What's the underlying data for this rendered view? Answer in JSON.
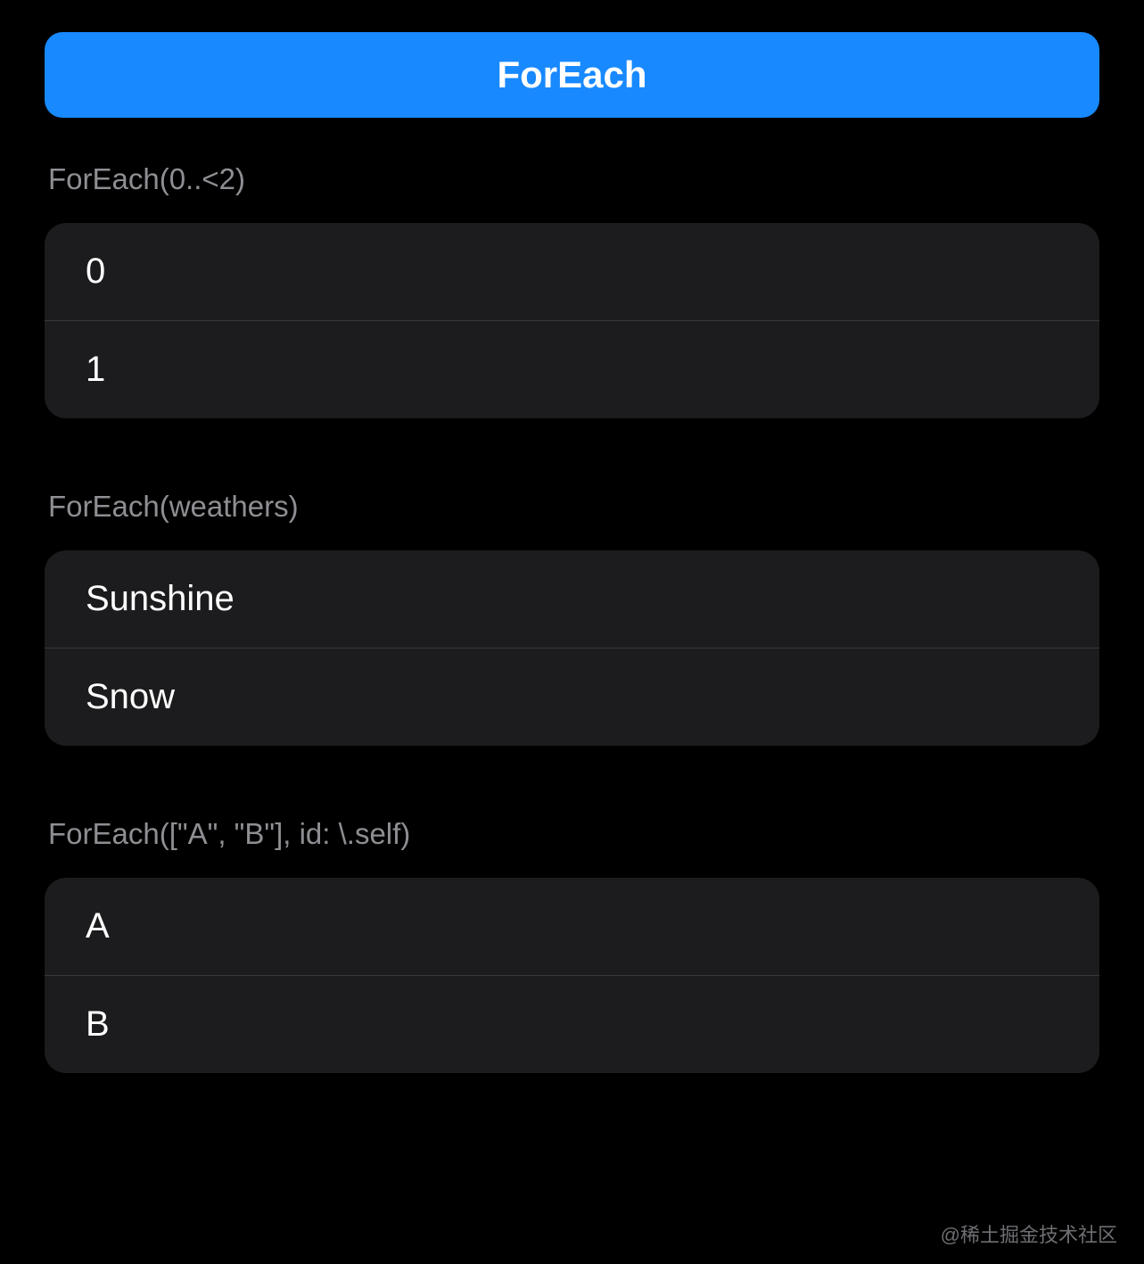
{
  "header": {
    "title": "ForEach"
  },
  "sections": [
    {
      "label": "ForEach(0..<2)",
      "items": [
        "0",
        "1"
      ]
    },
    {
      "label": "ForEach(weathers)",
      "items": [
        "Sunshine",
        "Snow"
      ]
    },
    {
      "label": "ForEach([\"A\", \"B\"], id: \\.self)",
      "items": [
        "A",
        "B"
      ]
    }
  ],
  "watermark": "@稀土掘金技术社区"
}
